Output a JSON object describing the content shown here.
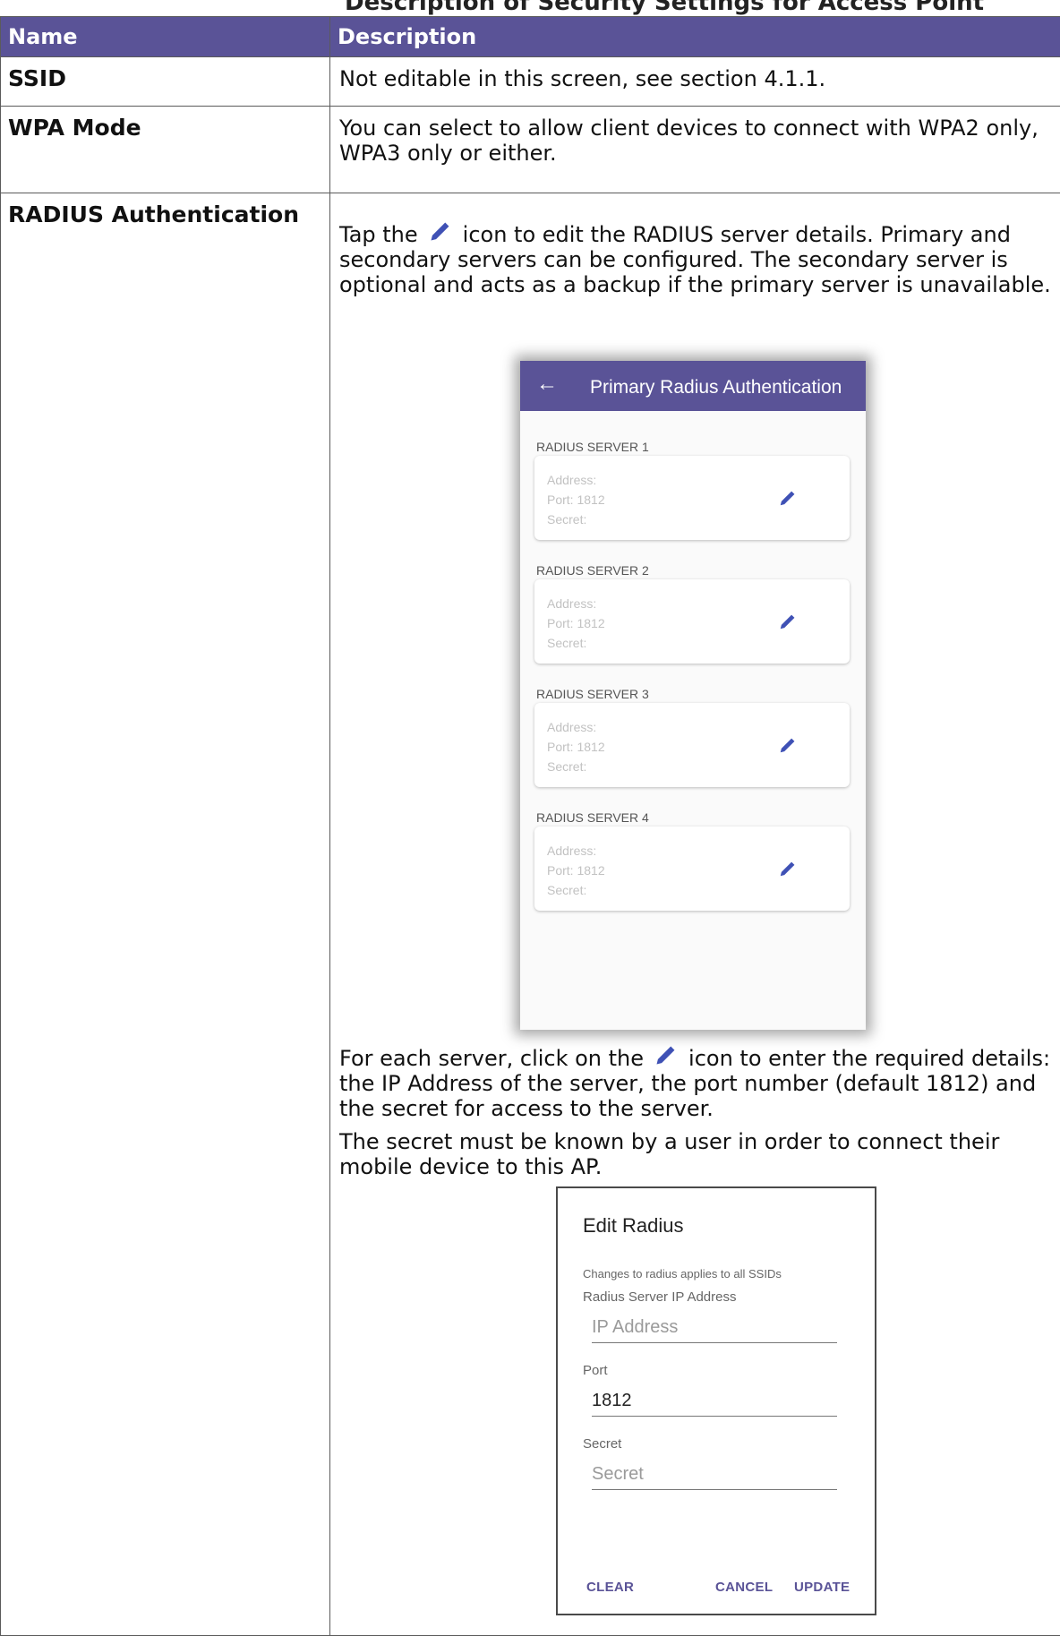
{
  "page_heading_cut": "Description of Security Settings for Access Point",
  "table": {
    "headers": {
      "name": "Name",
      "description": "Description"
    },
    "rows": {
      "ssid": {
        "name": "SSID",
        "description": "Not editable in this screen, see section 4.1.1."
      },
      "wpa": {
        "name": "WPA Mode",
        "description": "You can select to allow client devices to connect with WPA2 only, WPA3 only or either."
      },
      "radius": {
        "name": "RADIUS Authentication",
        "p1_before": "Tap the",
        "p1_after": "icon to edit the RADIUS server details. Primary and secondary servers can be configured. The secondary server is optional and acts as a backup if the primary server is unavailable.",
        "p2_before": "For each server, click on the",
        "p2_after": "icon to enter the required details: the IP Address of the server, the port number (default 1812) and the secret for access to the server.",
        "p3": "The secret must be known by a user in order to connect their mobile device to this AP."
      }
    }
  },
  "phone": {
    "back_icon": "arrow-back-icon",
    "title": "Primary Radius Authentication",
    "servers": [
      {
        "heading": "RADIUS SERVER 1",
        "address": "Address:",
        "port": "Port: 1812",
        "secret": "Secret:"
      },
      {
        "heading": "RADIUS SERVER 2",
        "address": "Address:",
        "port": "Port: 1812",
        "secret": "Secret:"
      },
      {
        "heading": "RADIUS SERVER 3",
        "address": "Address:",
        "port": "Port: 1812",
        "secret": "Secret:"
      },
      {
        "heading": "RADIUS SERVER 4",
        "address": "Address:",
        "port": "Port: 1812",
        "secret": "Secret:"
      }
    ]
  },
  "dialog": {
    "title": "Edit Radius",
    "note": "Changes to radius applies to all SSIDs",
    "ip_label": "Radius Server IP Address",
    "ip_placeholder": "IP Address",
    "port_label": "Port",
    "port_value": "1812",
    "secret_label": "Secret",
    "secret_placeholder": "Secret",
    "buttons": {
      "clear": "CLEAR",
      "cancel": "CANCEL",
      "update": "UPDATE"
    }
  },
  "colors": {
    "header_bg": "#5a5397",
    "accent": "#5a5397",
    "pencil": "#3f51b5"
  }
}
